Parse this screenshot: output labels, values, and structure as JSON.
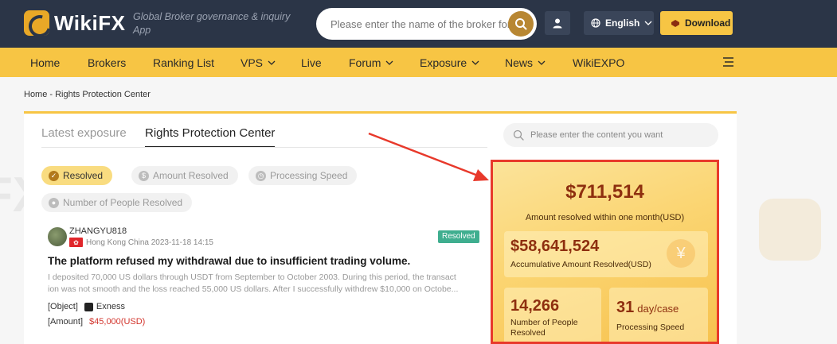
{
  "header": {
    "logo_text": "WikiFX",
    "tagline": "Global Broker governance & inquiry App",
    "search_placeholder": "Please enter the name of the broker for...",
    "language": "English",
    "download_label": "Download"
  },
  "nav": {
    "items": [
      "Home",
      "Brokers",
      "Ranking List",
      "VPS",
      "Live",
      "Forum",
      "Exposure",
      "News",
      "WikiEXPO"
    ]
  },
  "breadcrumb": "Home - Rights Protection Center",
  "tabs": [
    "Latest exposure",
    "Rights Protection Center"
  ],
  "content_search_placeholder": "Please enter the content you want",
  "filters": [
    "Resolved",
    "Amount Resolved",
    "Processing Speed",
    "Number of People Resolved"
  ],
  "post": {
    "username": "ZHANGYU818",
    "location_date": "Hong Kong China 2023-11-18 14:15",
    "status": "Resolved",
    "title": "The platform refused my withdrawal due to insufficient trading volume.",
    "body_line1": "I deposited 70,000 US dollars through USDT from September to October 2003. During this period, the transact",
    "body_line2": "ion was not smooth and the loss reached 55,000 US dollars. After I successfully withdrew $10,000 on Octobe...",
    "object_label": "[Object]",
    "object_value": "Exness",
    "amount_label": "[Amount]",
    "amount_value": "$45,000(USD)"
  },
  "stats": {
    "month_amount": "$711,514",
    "month_caption": "Amount resolved within one month(USD)",
    "accumulative_amount": "$58,641,524",
    "accumulative_caption": "Accumulative Amount Resolved(USD)",
    "people_value": "14,266",
    "people_caption": "Number of People Resolved",
    "speed_value": "31",
    "speed_unit": "day/case",
    "speed_caption": "Processing Speed"
  },
  "colors": {
    "topbar": "#2b3547",
    "accent_yellow": "#f7c544",
    "highlight_red": "#e8392b",
    "resolved_green": "#3fae8f"
  }
}
